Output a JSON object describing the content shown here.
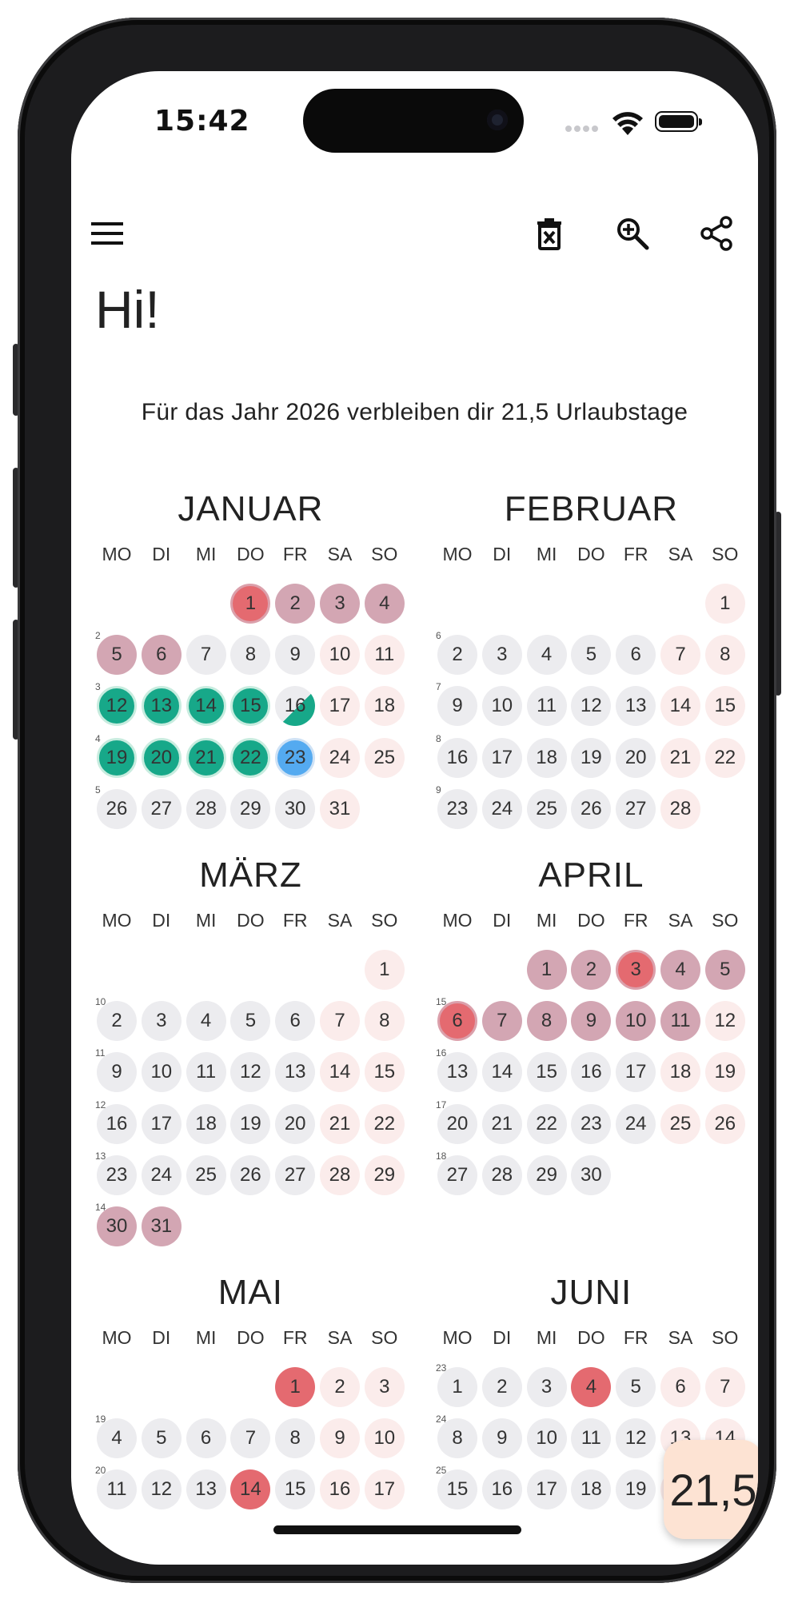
{
  "status": {
    "time": "15:42"
  },
  "header": {
    "greeting": "Hi!",
    "subtitle": "Für das Jahr 2026 verbleiben dir 21,5 Urlaubstage"
  },
  "toolbar": {
    "icons": [
      "menu-icon",
      "delete-calendar-icon",
      "zoom-in-icon",
      "share-icon"
    ]
  },
  "weekdays": [
    "MO",
    "DI",
    "MI",
    "DO",
    "FR",
    "SA",
    "SO"
  ],
  "legend_colors": {
    "workday": "#ececef",
    "weekend": "#fbeceb",
    "vacation": "#d3a6b3",
    "holiday": "#e46a70",
    "sick": "#17a889",
    "selected": "#54aaf0"
  },
  "months": [
    {
      "name": "JANUAR",
      "start": 3,
      "days": 31,
      "weeks": [
        "",
        "2",
        "3",
        "4",
        "5"
      ],
      "marks": {
        "1": "hol",
        "2": "vac",
        "3": "vac",
        "4": "vac",
        "5": "vac",
        "6": "vac",
        "12": "sick",
        "13": "sick",
        "14": "sick",
        "15": "sick",
        "16": "half",
        "19": "sick",
        "20": "sick",
        "21": "sick",
        "22": "sick",
        "23": "sel"
      }
    },
    {
      "name": "FEBRUAR",
      "start": 6,
      "days": 28,
      "weeks": [
        "",
        "6",
        "7",
        "8",
        "9"
      ],
      "marks": {}
    },
    {
      "name": "MÄRZ",
      "start": 6,
      "days": 31,
      "weeks": [
        "",
        "10",
        "11",
        "12",
        "13",
        "14"
      ],
      "marks": {
        "30": "vac",
        "31": "vac"
      }
    },
    {
      "name": "APRIL",
      "start": 2,
      "days": 30,
      "weeks": [
        "",
        "15",
        "16",
        "17",
        "18"
      ],
      "marks": {
        "1": "vac",
        "2": "vac",
        "3": "hol",
        "4": "vac",
        "5": "vac",
        "6": "hol",
        "7": "vac",
        "8": "vac",
        "9": "vac",
        "10": "vac",
        "11": "vac"
      }
    },
    {
      "name": "MAI",
      "start": 4,
      "days": 17,
      "weeks": [
        "",
        "19",
        "20"
      ],
      "marks": {
        "1": "holplain",
        "14": "holplain"
      }
    },
    {
      "name": "JUNI",
      "start": 0,
      "days": 21,
      "weeks": [
        "23",
        "24",
        "25"
      ],
      "marks": {
        "4": "holplain"
      }
    }
  ],
  "fab": {
    "label": "21,5"
  }
}
